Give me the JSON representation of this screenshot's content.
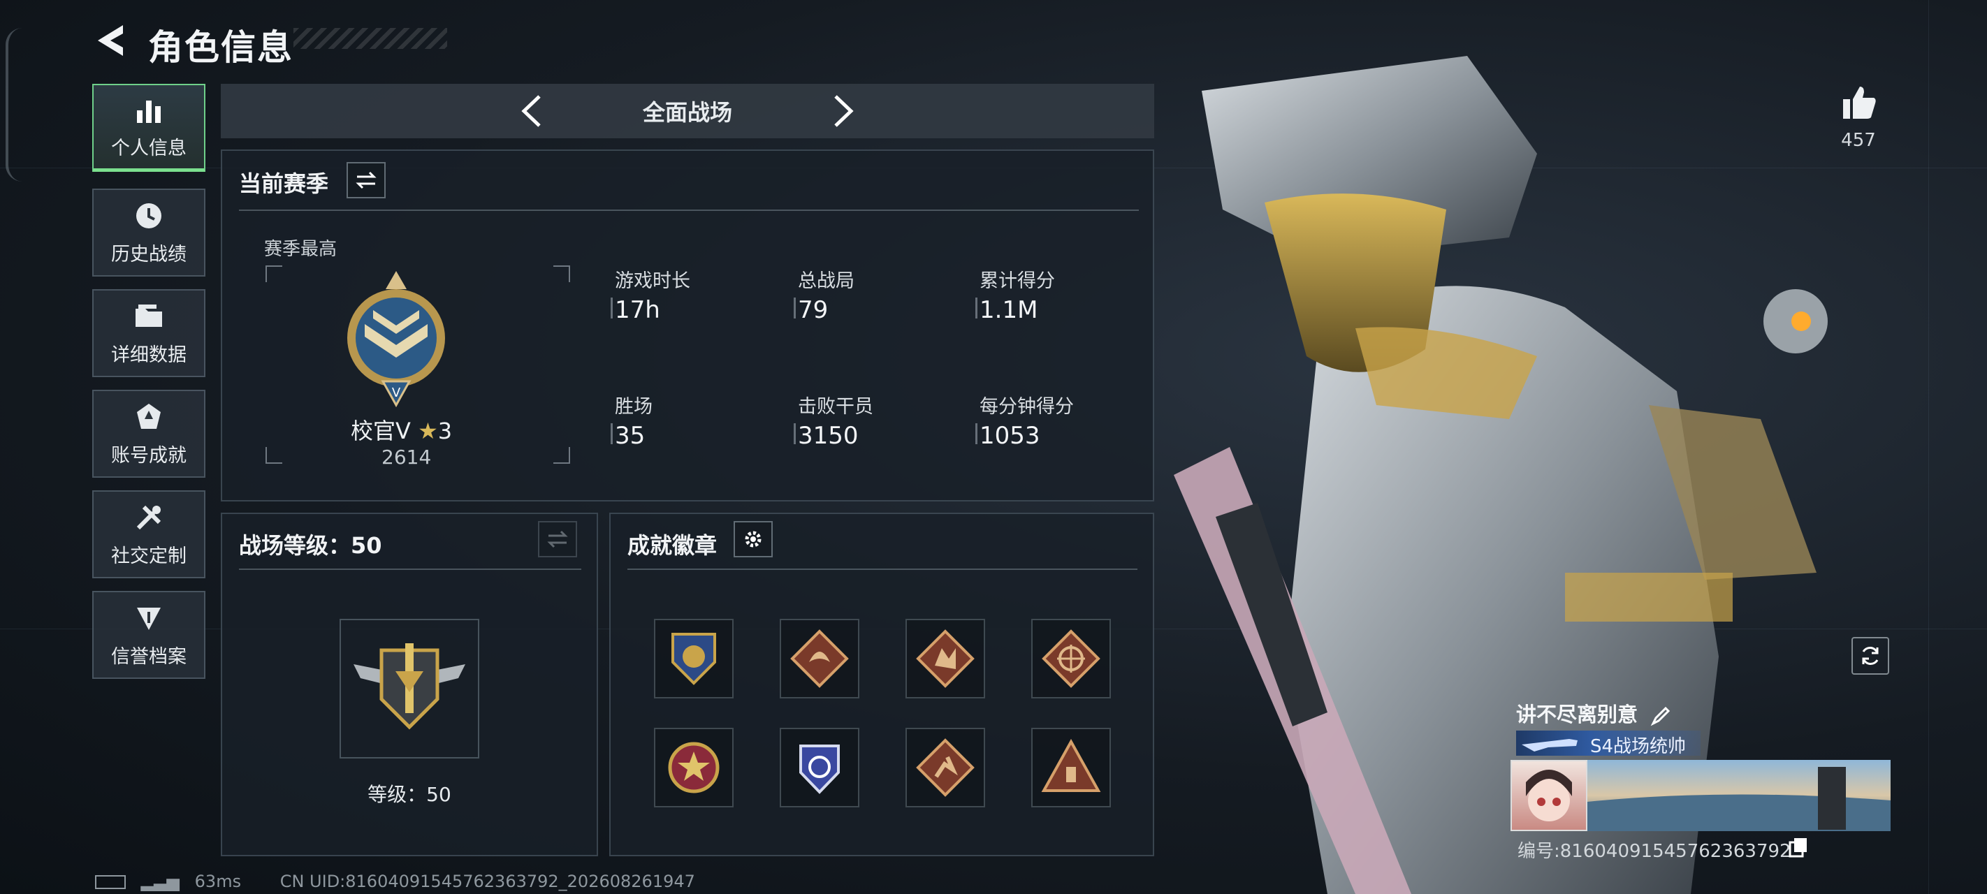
{
  "header": {
    "title": "角色信息"
  },
  "sidebar": {
    "items": [
      {
        "label": "个人信息",
        "icon": "bar-chart-icon",
        "active": true
      },
      {
        "label": "历史战绩",
        "icon": "clock-icon",
        "active": false
      },
      {
        "label": "详细数据",
        "icon": "folder-icon",
        "active": false
      },
      {
        "label": "账号成就",
        "icon": "achievement-icon",
        "active": false
      },
      {
        "label": "社交定制",
        "icon": "tools-icon",
        "active": false
      },
      {
        "label": "信誉档案",
        "icon": "reputation-icon",
        "active": false
      }
    ]
  },
  "mode": {
    "label": "全面战场"
  },
  "season": {
    "title": "当前赛季",
    "best_label": "赛季最高",
    "rank_name": "校官V",
    "rank_stars": "3",
    "rank_score": "2614",
    "stats": [
      {
        "label": "游戏时长",
        "value": "17h"
      },
      {
        "label": "总战局",
        "value": "79"
      },
      {
        "label": "累计得分",
        "value": "1.1M"
      },
      {
        "label": "胜场",
        "value": "35"
      },
      {
        "label": "击败干员",
        "value": "3150"
      },
      {
        "label": "每分钟得分",
        "value": "1053"
      }
    ]
  },
  "battle_level": {
    "title": "战场等级：50",
    "level_text": "等级：50"
  },
  "badges": {
    "title": "成就徽章",
    "items": [
      "shield-medal-icon",
      "dragon-emblem-icon",
      "wolf-emblem-icon",
      "wheel-emblem-icon",
      "star-medal-icon",
      "guard-shield-icon",
      "runner-emblem-icon",
      "triangle-emblem-icon"
    ]
  },
  "footer": {
    "ping": "63ms",
    "uid": "CN UID:8160409154576236379​2_202608261947"
  },
  "profile": {
    "likes": "457",
    "player_name": "讲不尽离别意",
    "title_tag": "S4战场统帅",
    "player_id": "编号:8160409154576236379​2"
  },
  "colors": {
    "accent_green": "#7be08e",
    "gold": "#c9a44a"
  }
}
